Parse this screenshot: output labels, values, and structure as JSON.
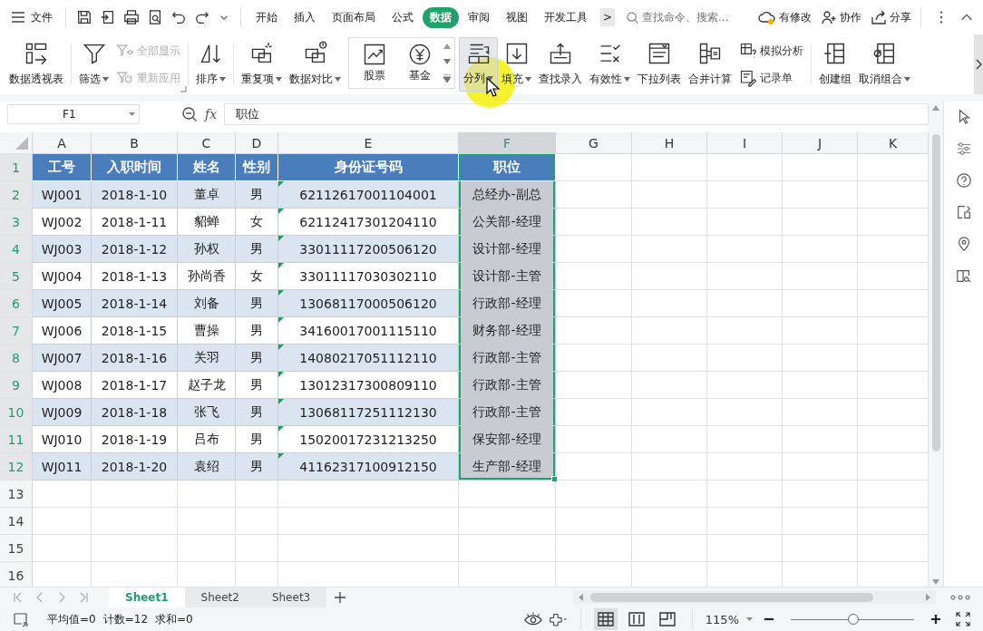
{
  "file_menu": "文件",
  "menu_tabs": [
    {
      "label": "开始",
      "selected": false
    },
    {
      "label": "插入",
      "selected": false
    },
    {
      "label": "页面布局",
      "selected": false
    },
    {
      "label": "公式",
      "selected": false
    },
    {
      "label": "数据",
      "selected": true
    },
    {
      "label": "审阅",
      "selected": false
    },
    {
      "label": "视图",
      "selected": false
    },
    {
      "label": "开发工具",
      "selected": false
    }
  ],
  "more_tabs": ">",
  "search": {
    "placeholder": "查找命令、搜索..."
  },
  "actions": [
    "有修改",
    "协作",
    "分享"
  ],
  "ribbon": [
    {
      "kind": "plain",
      "items": [
        {
          "kind": "large",
          "label": "数据透视表",
          "dropdown": false,
          "pressed": false
        }
      ]
    },
    {
      "kind": "plain",
      "launcher": true,
      "items": [
        {
          "kind": "large",
          "label": "筛选",
          "dropdown": true,
          "pressed": false
        },
        {
          "kind": "stack",
          "items": [
            {
              "label": "全部显示",
              "disabled": true
            },
            {
              "label": "重新应用",
              "disabled": true
            }
          ]
        }
      ]
    },
    {
      "kind": "plain",
      "items": [
        {
          "kind": "large",
          "label": "排序",
          "dropdown": true,
          "pressed": false
        }
      ]
    },
    {
      "kind": "plain",
      "items": [
        {
          "kind": "large",
          "label": "重复项",
          "dropdown": true,
          "pressed": false
        },
        {
          "kind": "large",
          "label": "数据对比",
          "dropdown": true,
          "pressed": false
        }
      ]
    },
    {
      "kind": "gallery",
      "items": [
        {
          "kind": "large",
          "label": "股票",
          "dropdown": false,
          "pressed": false
        },
        {
          "kind": "large",
          "label": "基金",
          "dropdown": false,
          "pressed": false
        }
      ]
    },
    {
      "kind": "plain",
      "items": [
        {
          "kind": "large",
          "label": "分列",
          "dropdown": true,
          "pressed": true
        },
        {
          "kind": "large",
          "label": "填充",
          "dropdown": true,
          "pressed": false
        },
        {
          "kind": "large",
          "label": "查找录入",
          "dropdown": false,
          "pressed": false
        },
        {
          "kind": "large",
          "label": "有效性",
          "dropdown": true,
          "pressed": false
        },
        {
          "kind": "large",
          "label": "下拉列表",
          "dropdown": false,
          "pressed": false
        },
        {
          "kind": "large",
          "label": "合并计算",
          "dropdown": false,
          "pressed": false
        },
        {
          "kind": "stack",
          "items": [
            {
              "label": "模拟分析",
              "disabled": false
            },
            {
              "label": "记录单",
              "disabled": false
            }
          ]
        }
      ]
    },
    {
      "kind": "plain",
      "items": [
        {
          "kind": "large",
          "label": "创建组",
          "dropdown": false,
          "pressed": false
        },
        {
          "kind": "large",
          "label": "取消组合",
          "dropdown": true,
          "pressed": false
        }
      ]
    }
  ],
  "name_box": "F1",
  "function_button": "fx",
  "formula": "职位",
  "columns": [
    {
      "letter": "A",
      "selected": false
    },
    {
      "letter": "B",
      "selected": false
    },
    {
      "letter": "C",
      "selected": false
    },
    {
      "letter": "D",
      "selected": false
    },
    {
      "letter": "E",
      "selected": false
    },
    {
      "letter": "F",
      "selected": true
    },
    {
      "letter": "G",
      "selected": false
    },
    {
      "letter": "H",
      "selected": false
    },
    {
      "letter": "I",
      "selected": false
    },
    {
      "letter": "J",
      "selected": false
    },
    {
      "letter": "K",
      "selected": false
    }
  ],
  "rows": [
    {
      "number": "1",
      "selected": true,
      "kind": "header",
      "text_number_warning": false,
      "values": [
        "工号",
        "入职时间",
        "姓名",
        "性别",
        "身份证号码",
        "职位"
      ]
    },
    {
      "number": "2",
      "selected": true,
      "kind": "data",
      "text_number_warning": true,
      "values": [
        "WJ001",
        "2018-1-10",
        "董卓",
        "男",
        "62112617001104001",
        "总经办-副总"
      ]
    },
    {
      "number": "3",
      "selected": true,
      "kind": "data",
      "text_number_warning": true,
      "values": [
        "WJ002",
        "2018-1-11",
        "貂蝉",
        "女",
        "62112417301204110",
        "公关部-经理"
      ]
    },
    {
      "number": "4",
      "selected": true,
      "kind": "data",
      "text_number_warning": true,
      "values": [
        "WJ003",
        "2018-1-12",
        "孙权",
        "男",
        "33011117200506120",
        "设计部-经理"
      ]
    },
    {
      "number": "5",
      "selected": true,
      "kind": "data",
      "text_number_warning": true,
      "values": [
        "WJ004",
        "2018-1-13",
        "孙尚香",
        "女",
        "33011117030302110",
        "设计部-主管"
      ]
    },
    {
      "number": "6",
      "selected": true,
      "kind": "data",
      "text_number_warning": true,
      "values": [
        "WJ005",
        "2018-1-14",
        "刘备",
        "男",
        "13068117000506120",
        "行政部-经理"
      ]
    },
    {
      "number": "7",
      "selected": true,
      "kind": "data",
      "text_number_warning": true,
      "values": [
        "WJ006",
        "2018-1-15",
        "曹操",
        "男",
        "34160017001115110",
        "财务部-经理"
      ]
    },
    {
      "number": "8",
      "selected": true,
      "kind": "data",
      "text_number_warning": true,
      "values": [
        "WJ007",
        "2018-1-16",
        "关羽",
        "男",
        "14080217051112110",
        "行政部-主管"
      ]
    },
    {
      "number": "9",
      "selected": true,
      "kind": "data",
      "text_number_warning": true,
      "values": [
        "WJ008",
        "2018-1-17",
        "赵子龙",
        "男",
        "13012317300809110",
        "行政部-主管"
      ]
    },
    {
      "number": "10",
      "selected": true,
      "kind": "data",
      "text_number_warning": true,
      "values": [
        "WJ009",
        "2018-1-18",
        "张飞",
        "男",
        "13068117251112130",
        "行政部-主管"
      ]
    },
    {
      "number": "11",
      "selected": true,
      "kind": "data",
      "text_number_warning": true,
      "values": [
        "WJ010",
        "2018-1-19",
        "吕布",
        "男",
        "15020017231213250",
        "保安部-经理"
      ]
    },
    {
      "number": "12",
      "selected": true,
      "kind": "data",
      "text_number_warning": true,
      "values": [
        "WJ011",
        "2018-1-20",
        "袁绍",
        "男",
        "41162317100912150",
        "生产部-经理"
      ]
    },
    {
      "number": "13",
      "selected": false,
      "kind": "empty",
      "text_number_warning": false
    },
    {
      "number": "14",
      "selected": false,
      "kind": "empty",
      "text_number_warning": false
    },
    {
      "number": "15",
      "selected": false,
      "kind": "empty",
      "text_number_warning": false
    },
    {
      "number": "16",
      "selected": false,
      "kind": "empty",
      "text_number_warning": false
    }
  ],
  "sheets": [
    {
      "label": "Sheet1",
      "selected": true
    },
    {
      "label": "Sheet2",
      "selected": false
    },
    {
      "label": "Sheet3",
      "selected": false
    }
  ],
  "status": [
    "平均值=0",
    "计数=12",
    "求和=0"
  ],
  "zoom": {
    "reading": "115%",
    "level": 0.51
  }
}
